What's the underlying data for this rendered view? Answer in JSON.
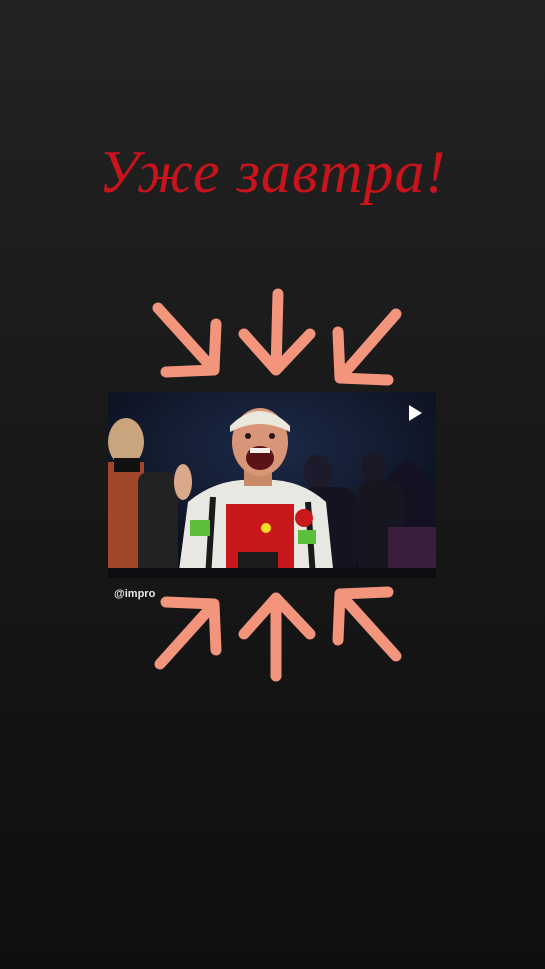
{
  "headline": "Уже завтра!",
  "video": {
    "play_icon": "play-icon",
    "watermark": "@impro"
  },
  "arrows": {
    "color": "#f3957d",
    "top_row": [
      "arrow-down-right",
      "arrow-down",
      "arrow-down-left"
    ],
    "bottom_row": [
      "arrow-up-right",
      "arrow-up",
      "arrow-up-left"
    ]
  },
  "colors": {
    "headline": "#c8141a",
    "background_top": "#232323",
    "background_bottom": "#0f0f10"
  }
}
